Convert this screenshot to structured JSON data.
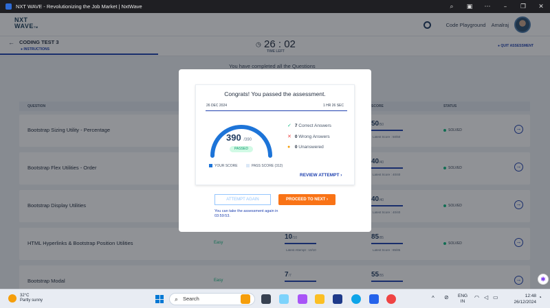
{
  "window": {
    "title": "NXT WAVE - Revolutionizing the Job Market | NxtWave"
  },
  "header": {
    "logo_line1": "NXT",
    "logo_line2": "WAVE",
    "logo_small": "TM",
    "code_playground": "Code Playground",
    "user_name": "Amalraj"
  },
  "subheader": {
    "test_title": "CODING TEST 3",
    "instructions_tab": "INSTRUCTIONS",
    "timer": "26 : 02",
    "timer_label": "TIME LEFT",
    "quit": "QUIT ASSESSMENT"
  },
  "main": {
    "completed_text": "You have completed all the Questions"
  },
  "table": {
    "headers": [
      "QUESTION",
      "SCORE",
      "STATUS"
    ],
    "rows": [
      {
        "question": "Bootstrap Sizing Utility - Percentage",
        "difficulty": "",
        "attempt_score": "",
        "attempt_total": "",
        "attempt_label": "",
        "score": "50",
        "total": "/50",
        "latest": "Latest Score : 50/50",
        "status": "SOLVED"
      },
      {
        "question": "Bootstrap Flex Utilities - Order",
        "difficulty": "",
        "attempt_score": "",
        "attempt_total": "",
        "attempt_label": "",
        "score": "40",
        "total": "/40",
        "latest": "Latest Score : 40/40",
        "status": "SOLVED"
      },
      {
        "question": "Bootstrap Display Utilities",
        "difficulty": "",
        "attempt_score": "",
        "attempt_total": "",
        "attempt_label": "",
        "score": "40",
        "total": "/40",
        "latest": "Latest Score : 40/40",
        "status": "SOLVED"
      },
      {
        "question": "HTML Hyperlinks & Bootstrap Position Utilities",
        "difficulty": "Easy",
        "attempt_score": "10",
        "attempt_total": "/10",
        "attempt_label": "Latest Attempt : 10/10",
        "score": "85",
        "total": "/85",
        "latest": "Latest Score : 85/85",
        "status": "SOLVED"
      },
      {
        "question": "Bootstrap Modal",
        "difficulty": "Easy",
        "attempt_score": "7",
        "attempt_total": "/7",
        "attempt_label": "",
        "score": "55",
        "total": "/55",
        "latest": "",
        "status": ""
      }
    ]
  },
  "modal": {
    "congrats": "Congrats! You passed the assessment.",
    "date": "26 DEC 2024",
    "duration": "1 HR 26 SEC",
    "score": "390",
    "score_total": "/390",
    "score_fraction": 1.0,
    "passed_badge": "PASSED",
    "correct_count": "7",
    "correct_label": "Correct Answers",
    "wrong_count": "0",
    "wrong_label": "Wrong Answers",
    "unanswered_count": "0",
    "unanswered_label": "Unanswered",
    "legend_your_score": "YOUR SCORE",
    "legend_pass_score": "PASS SCORE (312)",
    "review": "REVIEW ATTEMPT",
    "attempt_again": "ATTEMPT AGAIN",
    "proceed": "PROCEED TO NEXT",
    "retake_note": "You can take the assessment again in 03:59:53."
  },
  "taskbar": {
    "temp": "32°C",
    "weather": "Partly sunny",
    "search": "Search",
    "lang1": "ENG",
    "lang2": "IN",
    "time": "12:48",
    "date": "26/12/2024"
  },
  "colors": {
    "accent": "#1e40af",
    "orange": "#f97316",
    "success": "#10b981"
  }
}
